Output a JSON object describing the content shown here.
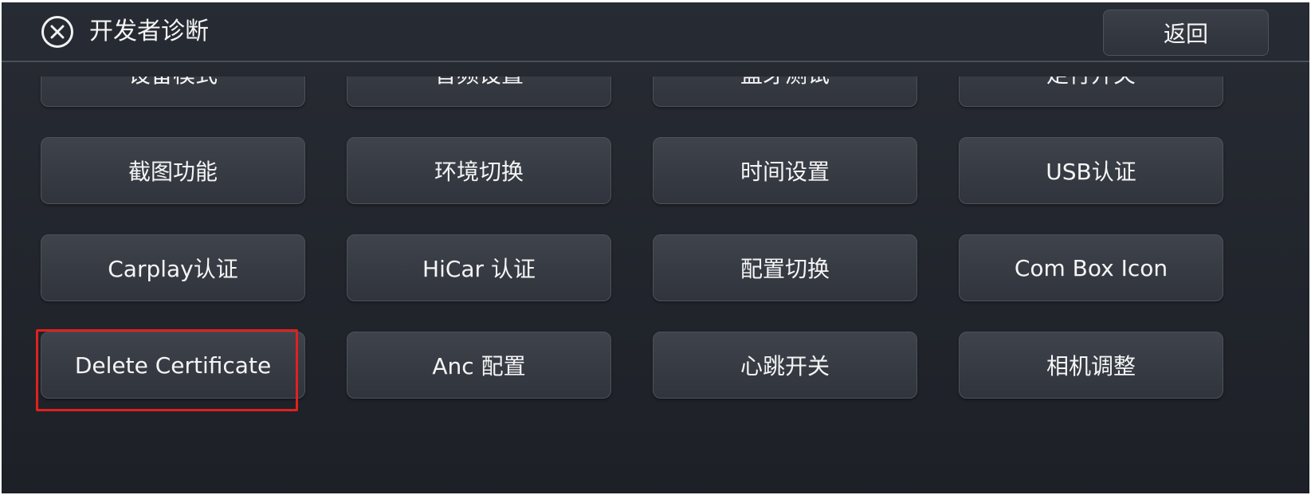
{
  "header": {
    "title": "开发者诊断",
    "close_icon": "close-circle-icon",
    "back_label": "返回"
  },
  "grid": {
    "items": [
      {
        "label": "设备模式"
      },
      {
        "label": "音频设置"
      },
      {
        "label": "蓝牙测试"
      },
      {
        "label": "走行开关"
      },
      {
        "label": "截图功能"
      },
      {
        "label": "环境切换"
      },
      {
        "label": "时间设置"
      },
      {
        "label": "USB认证"
      },
      {
        "label": "Carplay认证"
      },
      {
        "label": "HiCar 认证"
      },
      {
        "label": "配置切换"
      },
      {
        "label": "Com Box Icon"
      },
      {
        "label": "Delete Certificate",
        "highlighted": true
      },
      {
        "label": "Anc 配置"
      },
      {
        "label": "心跳开关"
      },
      {
        "label": "相机调整"
      }
    ]
  },
  "colors": {
    "background": "#23262d",
    "tile": "#393d46",
    "text": "#f5f5f5",
    "highlight": "#e0211d"
  }
}
